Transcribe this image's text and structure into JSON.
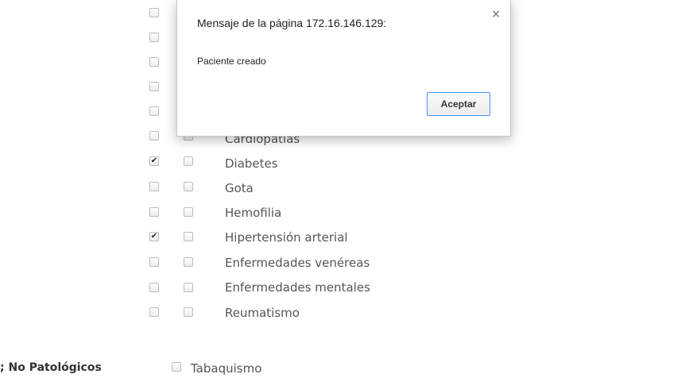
{
  "dialog": {
    "title": "Mensaje de la página 172.16.146.129:",
    "message": "Paciente creado",
    "ok_label": "Aceptar",
    "close_glyph": "×"
  },
  "conditions": [
    {
      "label": "Cardiopatías",
      "checked": false
    },
    {
      "label": "Diabetes",
      "checked": true
    },
    {
      "label": "Gota",
      "checked": false
    },
    {
      "label": "Hemofilia",
      "checked": false
    },
    {
      "label": "Hipertensión arterial",
      "checked": true
    },
    {
      "label": "Enfermedades venéreas",
      "checked": false
    },
    {
      "label": "Enfermedades mentales",
      "checked": false
    },
    {
      "label": "Reumatismo",
      "checked": false
    }
  ],
  "non_pathological": {
    "section_label": "; No Patológicos",
    "items": [
      {
        "label": "Tabaquismo",
        "checked": false
      }
    ]
  }
}
